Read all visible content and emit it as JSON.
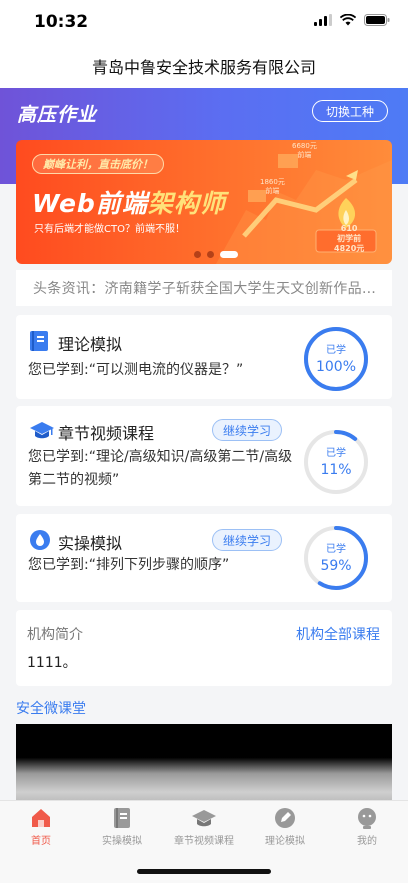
{
  "status": {
    "time": "10:32"
  },
  "header": {
    "title": "青岛中鲁安全技术服务有限公司"
  },
  "hero": {
    "title": "高压作业",
    "switch_label": "切换工种"
  },
  "banner": {
    "slogan": "巅峰让利，直击底价！",
    "headline_part1": "Web前端",
    "headline_part2": "架构师",
    "subtitle": "只有后端才能做CTO？前端不服！",
    "price_tag_1": "6680元\n前端",
    "price_tag_2": "1860元\n前端",
    "price_tag_3": "610\n初学前\n4820元",
    "slide_count": 3,
    "active_slide": 3
  },
  "news": {
    "text": "头条资讯：济南籍学子斩获全国大学生天文创新作品竞赛一等奖"
  },
  "courses": [
    {
      "title": "理论模拟",
      "desc": "您已学到:“可以测电流的仪器是？”",
      "progress_label": "已学",
      "progress": "100%",
      "progress_value": 100,
      "has_continue": false
    },
    {
      "title": "章节视频课程",
      "desc": "您已学到:“理论/高级知识/高级第二节/高级第二节的视频”",
      "progress_label": "已学",
      "progress": "11%",
      "progress_value": 11,
      "has_continue": true,
      "continue_label": "继续学习"
    },
    {
      "title": "实操模拟",
      "desc": "您已学到:“排列下列步骤的顺序”",
      "progress_label": "已学",
      "progress": "59%",
      "progress_value": 59,
      "has_continue": true,
      "continue_label": "继续学习"
    }
  ],
  "org": {
    "title": "机构简介",
    "link": "机构全部课程",
    "text": "1111。"
  },
  "micro": {
    "title": "安全微课堂"
  },
  "colors": {
    "accent": "#3a7cef",
    "ring_track": "#e6e6e6",
    "tab_active": "#f05a4a",
    "tab_inactive": "#999999"
  },
  "tabs": [
    {
      "label": "首页",
      "icon": "home-icon",
      "active": true
    },
    {
      "label": "实操模拟",
      "icon": "document-icon",
      "active": false
    },
    {
      "label": "章节视频课程",
      "icon": "graduation-cap-icon",
      "active": false
    },
    {
      "label": "理论模拟",
      "icon": "pen-icon",
      "active": false
    },
    {
      "label": "我的",
      "icon": "user-face-icon",
      "active": false
    }
  ]
}
